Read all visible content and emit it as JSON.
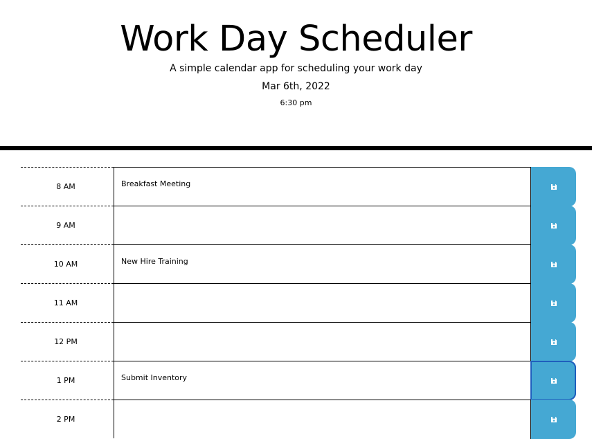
{
  "header": {
    "title": "Work Day Scheduler",
    "subtitle": "A simple calendar app for scheduling your work day",
    "date": "Mar 6th, 2022",
    "time": "6:30 pm"
  },
  "colors": {
    "save_button": "#45a8d3",
    "focus_ring": "#1f5fbd",
    "rule": "#000000"
  },
  "icons": {
    "save": "floppy-disk-icon"
  },
  "rows": [
    {
      "hour": "8 AM",
      "text": "Breakfast Meeting"
    },
    {
      "hour": "9 AM",
      "text": ""
    },
    {
      "hour": "10 AM",
      "text": "New Hire Training"
    },
    {
      "hour": "11 AM",
      "text": ""
    },
    {
      "hour": "12 PM",
      "text": ""
    },
    {
      "hour": "1 PM",
      "text": "Submit Inventory"
    },
    {
      "hour": "2 PM",
      "text": ""
    }
  ]
}
